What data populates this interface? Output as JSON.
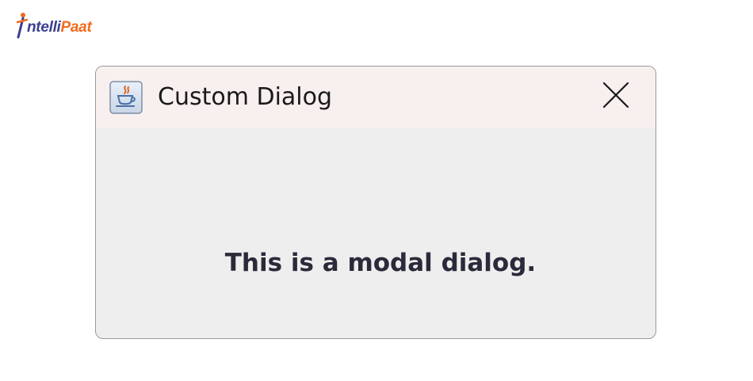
{
  "brand": {
    "prefix": "ntelli",
    "suffix": "Paat",
    "initial": "I",
    "primary_color": "#3b3f8f",
    "accent_color": "#f26b1d"
  },
  "dialog": {
    "title": "Custom Dialog",
    "icon": "java-coffee-icon",
    "close_icon": "close-icon",
    "message": "This is a modal dialog.",
    "titlebar_color": "#f8efef",
    "body_color": "#eeeeee"
  }
}
